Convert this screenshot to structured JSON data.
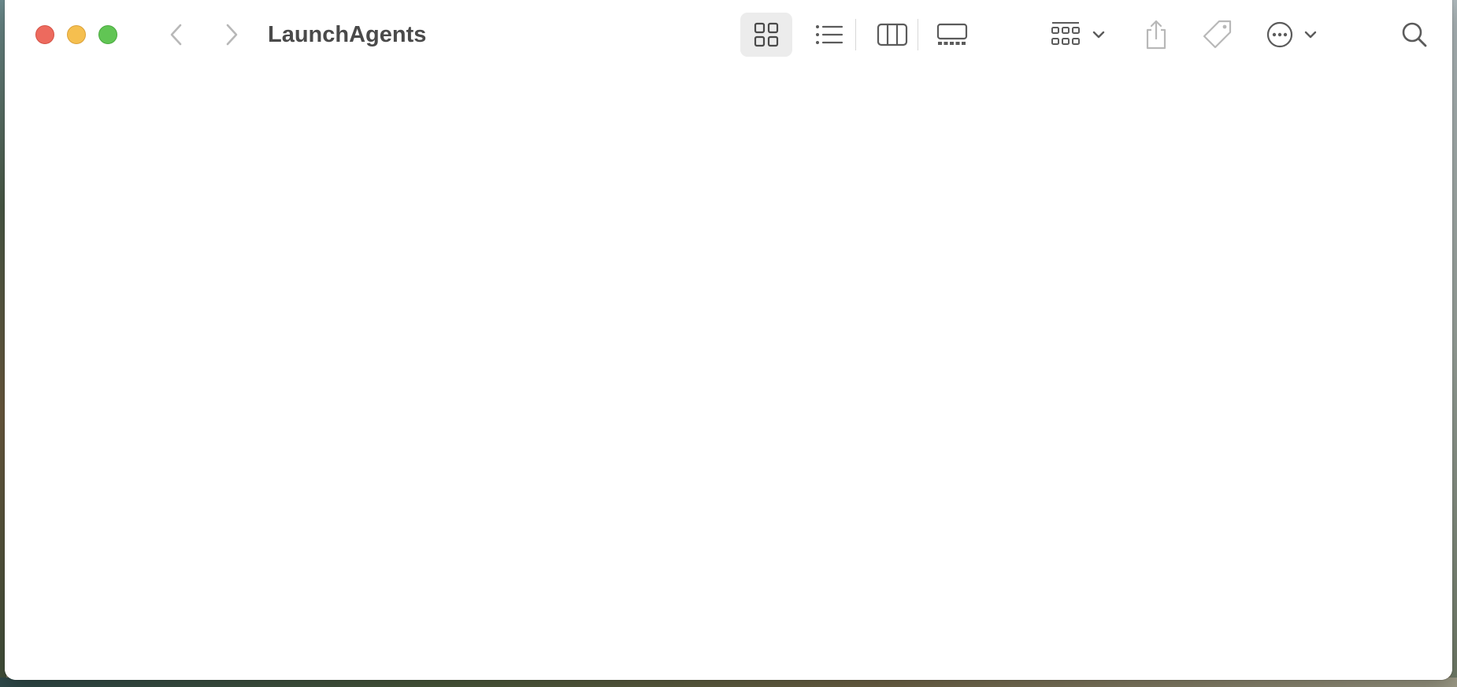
{
  "window": {
    "title": "LaunchAgents"
  },
  "toolbar": {
    "navigation": [
      {
        "name": "back",
        "icon": "chevron-left-icon",
        "enabled": false
      },
      {
        "name": "forward",
        "icon": "chevron-right-icon",
        "enabled": false
      }
    ],
    "view_modes": [
      {
        "name": "icons",
        "icon": "grid-icon",
        "selected": true
      },
      {
        "name": "list",
        "icon": "list-icon",
        "selected": false
      },
      {
        "name": "columns",
        "icon": "columns-icon",
        "selected": false
      },
      {
        "name": "gallery",
        "icon": "gallery-icon",
        "selected": false
      }
    ],
    "actions": [
      {
        "name": "group",
        "icon": "group-grid-icon",
        "has_menu": true,
        "enabled": true
      },
      {
        "name": "share",
        "icon": "share-icon",
        "has_menu": false,
        "enabled": false
      },
      {
        "name": "tags",
        "icon": "tag-icon",
        "has_menu": false,
        "enabled": false
      },
      {
        "name": "more",
        "icon": "ellipsis-circle-icon",
        "has_menu": true,
        "enabled": true
      },
      {
        "name": "search",
        "icon": "search-icon",
        "has_menu": false,
        "enabled": true
      }
    ]
  },
  "content": {
    "items": []
  },
  "colors": {
    "close": "#ed6a5e",
    "minimize": "#f5bf4f",
    "maximize": "#61c554",
    "title_text": "#4a4a4a",
    "icon_active": "#5b5b5b",
    "icon_disabled": "#b8b8b8",
    "selected_view_bg": "#ececec"
  }
}
